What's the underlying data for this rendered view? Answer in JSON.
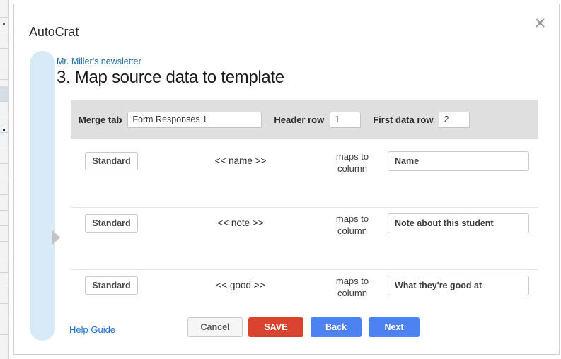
{
  "app": {
    "title": "AutoCrat",
    "close_icon": "close-icon"
  },
  "breadcrumb": {
    "label": "Mr. Miller's newsletter"
  },
  "page": {
    "title": "3. Map source data to template"
  },
  "rail": {
    "expand_icon": "triangle-right-icon"
  },
  "settings": {
    "merge_tab_label": "Merge tab",
    "merge_tab_value": "Form Responses 1",
    "header_row_label": "Header row",
    "header_row_value": "1",
    "first_data_row_label": "First data row",
    "first_data_row_value": "2"
  },
  "mapping": {
    "maps_to_line1": "maps to",
    "maps_to_line2": "column",
    "rows": [
      {
        "type_label": "Standard",
        "tag": "<< name >>",
        "column_value": "Name"
      },
      {
        "type_label": "Standard",
        "tag": "<< note >>",
        "column_value": "Note about this student"
      },
      {
        "type_label": "Standard",
        "tag": "<< good >>",
        "column_value": "What they're good at"
      }
    ]
  },
  "footer": {
    "help_guide_label": "Help Guide",
    "cancel_label": "Cancel",
    "save_label": "SAVE",
    "back_label": "Back",
    "next_label": "Next"
  },
  "colors": {
    "save_red": "#d84430",
    "action_blue": "#4d82f3",
    "link_blue": "#1a73c8",
    "breadcrumb_blue": "#1f6b9e",
    "rail_blue": "#d8e9f8",
    "settings_bar_gray": "#dfdfdf"
  }
}
